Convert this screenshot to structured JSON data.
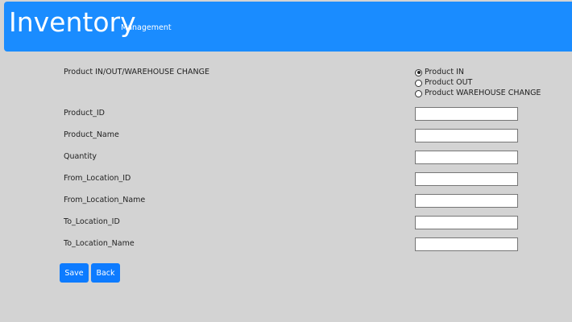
{
  "header": {
    "title": "Inventory",
    "subtitle": "Management",
    "background_color": "#1a8cff"
  },
  "form": {
    "mode_label": "Product IN/OUT/WAREHOUSE CHANGE",
    "mode_options": [
      {
        "label": "Product IN",
        "checked": true
      },
      {
        "label": "Product OUT",
        "checked": false
      },
      {
        "label": "Product WAREHOUSE CHANGE",
        "checked": false
      }
    ],
    "fields": [
      {
        "label": "Product_ID",
        "value": ""
      },
      {
        "label": "Product_Name",
        "value": ""
      },
      {
        "label": "Quantity",
        "value": ""
      },
      {
        "label": "From_Location_ID",
        "value": ""
      },
      {
        "label": "From_Location_Name",
        "value": ""
      },
      {
        "label": "To_Location_ID",
        "value": ""
      },
      {
        "label": "To_Location_Name",
        "value": ""
      }
    ]
  },
  "buttons": {
    "save_label": "Save",
    "back_label": "Back",
    "color": "#0d7bff"
  },
  "page_background": "#d3d3d3"
}
